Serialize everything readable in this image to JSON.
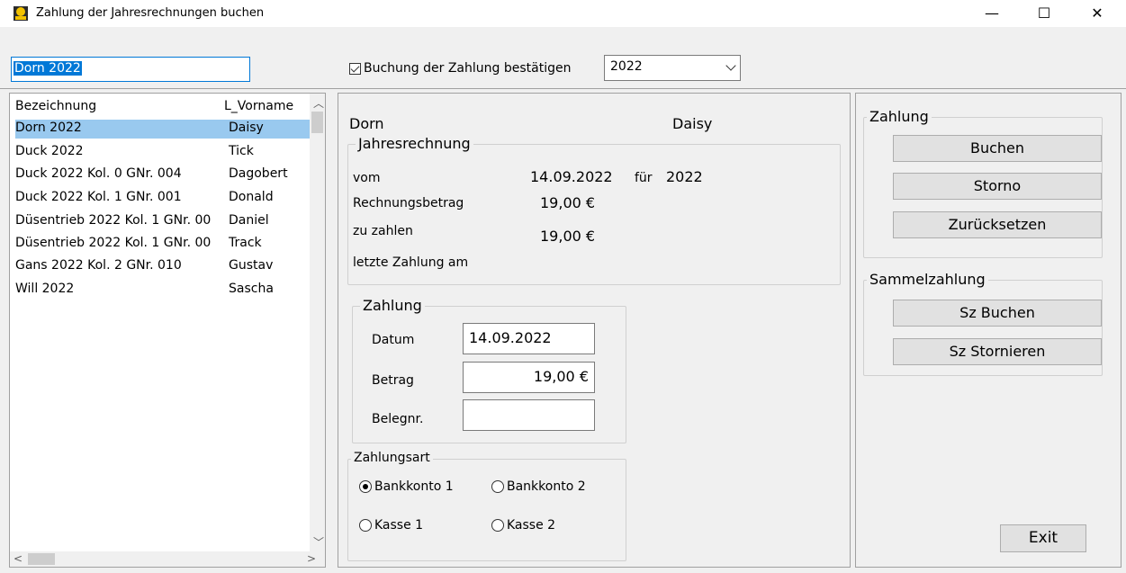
{
  "window": {
    "title": "Zahlung der Jahresrechnungen buchen",
    "minimize": "—",
    "maximize": "☐",
    "close": "✕"
  },
  "toolbar": {
    "search_value": "Dorn 2022",
    "confirm_label": "Buchung der Zahlung bestätigen",
    "year_value": "2022"
  },
  "list": {
    "col1": "Bezeichnung",
    "col2": "L_Vorname",
    "rows": [
      {
        "name": "Dorn 2022",
        "vorname": "Daisy"
      },
      {
        "name": "Duck 2022",
        "vorname": "Tick"
      },
      {
        "name": "Duck 2022 Kol. 0 GNr. 004",
        "vorname": "Dagobert"
      },
      {
        "name": "Duck 2022 Kol. 1 GNr. 001",
        "vorname": "Donald"
      },
      {
        "name": "Düsentrieb 2022 Kol. 1 GNr. 00",
        "vorname": "Daniel"
      },
      {
        "name": "Düsentrieb 2022 Kol. 1 GNr. 00",
        "vorname": "Track"
      },
      {
        "name": "Gans 2022 Kol. 2 GNr. 010",
        "vorname": "Gustav"
      },
      {
        "name": "Will 2022",
        "vorname": "Sascha"
      }
    ]
  },
  "detail": {
    "nachname": "Dorn",
    "vorname": "Daisy",
    "jahresrechnung": {
      "legend": "Jahresrechnung",
      "vom_label": "vom",
      "vom_value": "14.09.2022",
      "fuer_label": "für",
      "fuer_value": "2022",
      "betrag_label": "Rechnungsbetrag",
      "betrag_value": "19,00 €",
      "zuzahlen_label": "zu zahlen",
      "zuzahlen_value": "19,00 €",
      "letzte_label": "letzte Zahlung am"
    },
    "zahlung": {
      "legend": "Zahlung",
      "datum_label": "Datum",
      "datum_value": "14.09.2022",
      "betrag_label": "Betrag",
      "betrag_value": "19,00 €",
      "beleg_label": "Belegnr.",
      "beleg_value": ""
    },
    "zahlungsart": {
      "legend": "Zahlungsart",
      "options": [
        "Bankkonto 1",
        "Bankkonto 2",
        "Kasse 1",
        "Kasse 2"
      ],
      "selected": "Bankkonto 1"
    }
  },
  "actions": {
    "zahlung_legend": "Zahlung",
    "buchen": "Buchen",
    "storno": "Storno",
    "zuruecksetzen": "Zurücksetzen",
    "sammel_legend": "Sammelzahlung",
    "sz_buchen": "Sz Buchen",
    "sz_stornieren": "Sz Stornieren",
    "exit": "Exit"
  }
}
